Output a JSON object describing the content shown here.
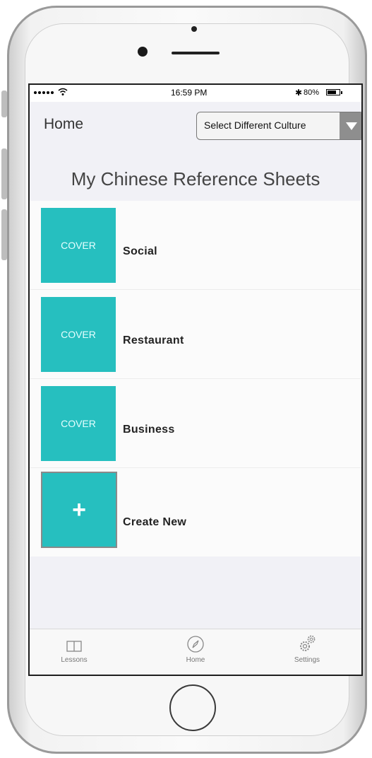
{
  "status_bar": {
    "time": "16:59 PM",
    "battery_percent": "80%",
    "battery_level": 0.8
  },
  "nav": {
    "title": "Home",
    "culture_select": "Select Different Culture"
  },
  "page_title": "My Chinese Reference Sheets",
  "sheets": [
    {
      "cover": "COVER",
      "label": "Social"
    },
    {
      "cover": "COVER",
      "label": "Restaurant"
    },
    {
      "cover": "COVER",
      "label": "Business"
    }
  ],
  "create_new": {
    "icon": "+",
    "label": "Create New"
  },
  "tabs": [
    {
      "label": "Lessons",
      "icon": "book-icon"
    },
    {
      "label": "Home",
      "icon": "compass-icon"
    },
    {
      "label": "Settings",
      "icon": "gears-icon"
    }
  ],
  "colors": {
    "cover": "#26bfbf",
    "screen_bg": "#f1f1f6"
  }
}
